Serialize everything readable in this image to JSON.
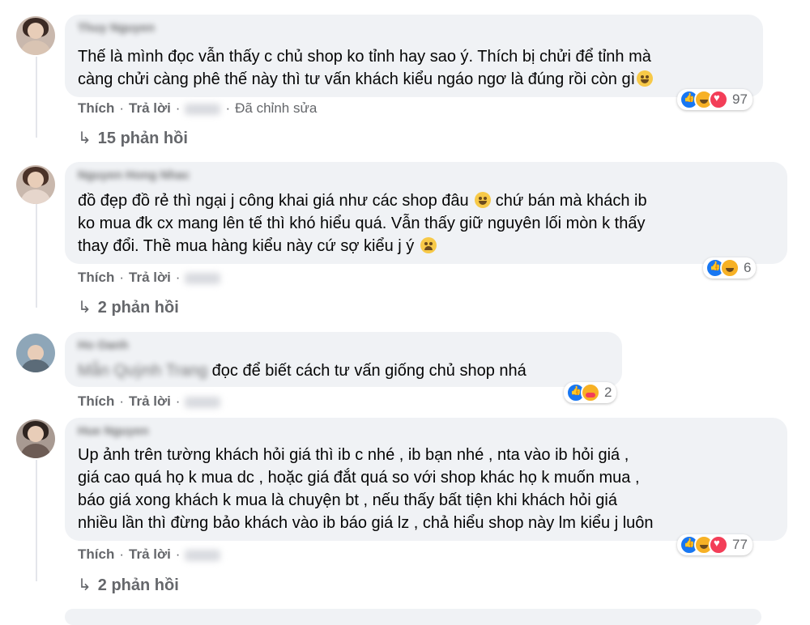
{
  "comments": [
    {
      "author": "Thuy Nguyen",
      "lines": [
        "Thế là mình đọc vẫn thấy c chủ shop ko tỉnh hay sao ý. Thích bị chửi để tỉnh mà",
        "càng chửi càng phê thế này thì tư vấn khách kiểu ngáo ngơ là đúng rồi còn gì"
      ],
      "like": "Thích",
      "reply": "Trả lời",
      "edited": "Đã chỉnh sửa",
      "reaction_count": "97",
      "replies": "15 phản hồi"
    },
    {
      "author": "Nguyen Hong Nhac",
      "lines": [
        "đồ đẹp đồ rẻ thì ngại j công khai giá như các shop đâu",
        "chứ bán mà khách ib",
        "ko mua đk cx mang lên tế thì khó hiểu quá. Vẫn thấy giữ nguyên lối mòn k thấy",
        "thay đổi. Thề mua hàng kiểu này cứ sợ kiểu j ý"
      ],
      "like": "Thích",
      "reply": "Trả lời",
      "reaction_count": "6",
      "replies": "2 phản hồi"
    },
    {
      "author": "Ho Oanh",
      "mention": "Mẫn Quỳnh Trang",
      "lines": [
        "đọc để biết cách tư vấn giống chủ shop nhá"
      ],
      "like": "Thích",
      "reply": "Trả lời",
      "reaction_count": "2"
    },
    {
      "author": "Hue Nguyen",
      "lines": [
        "Up ảnh trên tường khách hỏi giá thì ib c nhé , ib bạn nhé , nta vào ib hỏi giá ,",
        "giá cao quá họ k mua dc , hoặc giá đắt quá so với shop khác họ k muốn mua ,",
        "báo giá xong khách k mua là chuyện bt , nếu thấy bất tiện khi khách hỏi giá",
        "nhiều lần thì đừng bảo khách vào ib báo giá lz , chả hiểu shop này lm kiểu j luôn"
      ],
      "like": "Thích",
      "reply": "Trả lời",
      "reaction_count": "77",
      "replies": "2 phản hồi"
    }
  ],
  "icons": {
    "replies_arrow": "↳",
    "separator": "·"
  }
}
